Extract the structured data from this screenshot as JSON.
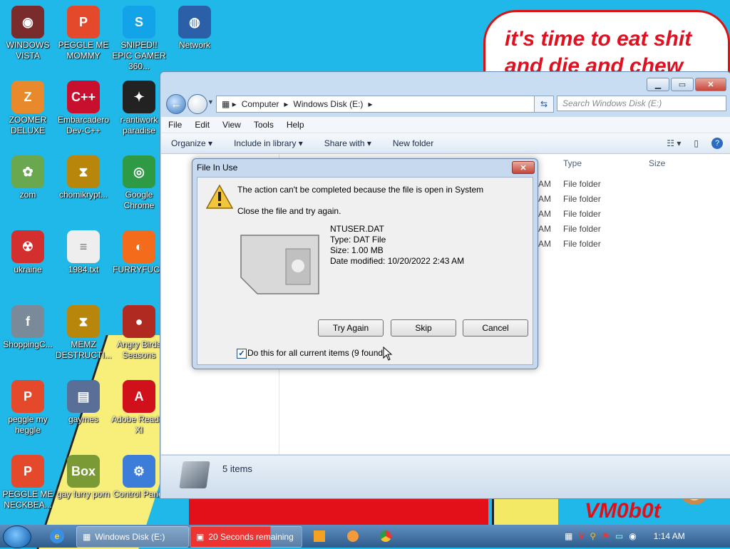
{
  "wallpaper": {
    "speech_text": "it's time to eat shit and die and chew",
    "logo_text": "VM0b0t"
  },
  "desktop_icons": [
    {
      "label": "WINDOWS VISTA",
      "icon": "vista-icon"
    },
    {
      "label": "PEGGLE ME MOMMY",
      "icon": "peggle-icon"
    },
    {
      "label": "SNIPED!! EPIC GAMER 360...",
      "icon": "skype-icon"
    },
    {
      "label": "Network",
      "icon": "network-icon"
    },
    {
      "label": "ZOOMER DELUXE",
      "icon": "zoomer-icon"
    },
    {
      "label": "Embarcadero Dev-C++",
      "icon": "devcpp-icon"
    },
    {
      "label": "r-antiwork paradise",
      "icon": "antiwork-icon"
    },
    {
      "label": "zom",
      "icon": "zom-icon"
    },
    {
      "label": "chomikrypt...",
      "icon": "hourglass-icon"
    },
    {
      "label": "Google Chrome",
      "icon": "chrome-icon"
    },
    {
      "label": "ukraine",
      "icon": "radiation-icon"
    },
    {
      "label": "1984.txt",
      "icon": "text-file-icon"
    },
    {
      "label": "FURRYFUCK",
      "icon": "firefox-icon"
    },
    {
      "label": "ShoppingC...",
      "icon": "flash-icon"
    },
    {
      "label": "MEMZ DESTRUCTI...",
      "icon": "hourglass-icon"
    },
    {
      "label": "Angry Birds Seasons",
      "icon": "angry-birds-icon"
    },
    {
      "label": "peggle my heggle",
      "icon": "peggle-icon"
    },
    {
      "label": "gaymes",
      "icon": "games-folder-icon"
    },
    {
      "label": "Adobe Reader XI",
      "icon": "adobe-reader-icon"
    },
    {
      "label": "PEGGLE ME NECKBEA...",
      "icon": "peggle-icon"
    },
    {
      "label": "gay furry porn",
      "icon": "box-icon"
    },
    {
      "label": "Control Panel",
      "icon": "control-panel-icon"
    }
  ],
  "explorer": {
    "address": [
      "Computer",
      "Windows Disk (E:)"
    ],
    "search_placeholder": "Search Windows Disk (E:)",
    "menu": [
      "File",
      "Edit",
      "View",
      "Tools",
      "Help"
    ],
    "toolbar": {
      "organize": "Organize",
      "include": "Include in library",
      "share": "Share with",
      "new_folder": "New folder"
    },
    "columns": {
      "type": "Type",
      "size": "Size"
    },
    "rows": [
      {
        "time": "AM",
        "type": "File folder"
      },
      {
        "time": "AM",
        "type": "File folder"
      },
      {
        "time": "AM",
        "type": "File folder"
      },
      {
        "time": "AM",
        "type": "File folder"
      },
      {
        "time": "AM",
        "type": "File folder"
      }
    ],
    "status": "5 items"
  },
  "dialog": {
    "title": "File In Use",
    "message": "The action can't be completed because the file is open in System",
    "hint": "Close the file and try again.",
    "file_name": "NTUSER.DAT",
    "file_type": "Type: DAT File",
    "file_size": "Size: 1.00 MB",
    "file_date": "Date modified: 10/20/2022 2:43 AM",
    "try_again": "Try Again",
    "skip": "Skip",
    "cancel": "Cancel",
    "checkbox_label": "Do this for all current items (9 found)",
    "checkbox_checked": true
  },
  "taskbar": {
    "items": [
      "Windows Disk (E:)",
      "20 Seconds remaining"
    ],
    "clock": "1:14 AM"
  }
}
